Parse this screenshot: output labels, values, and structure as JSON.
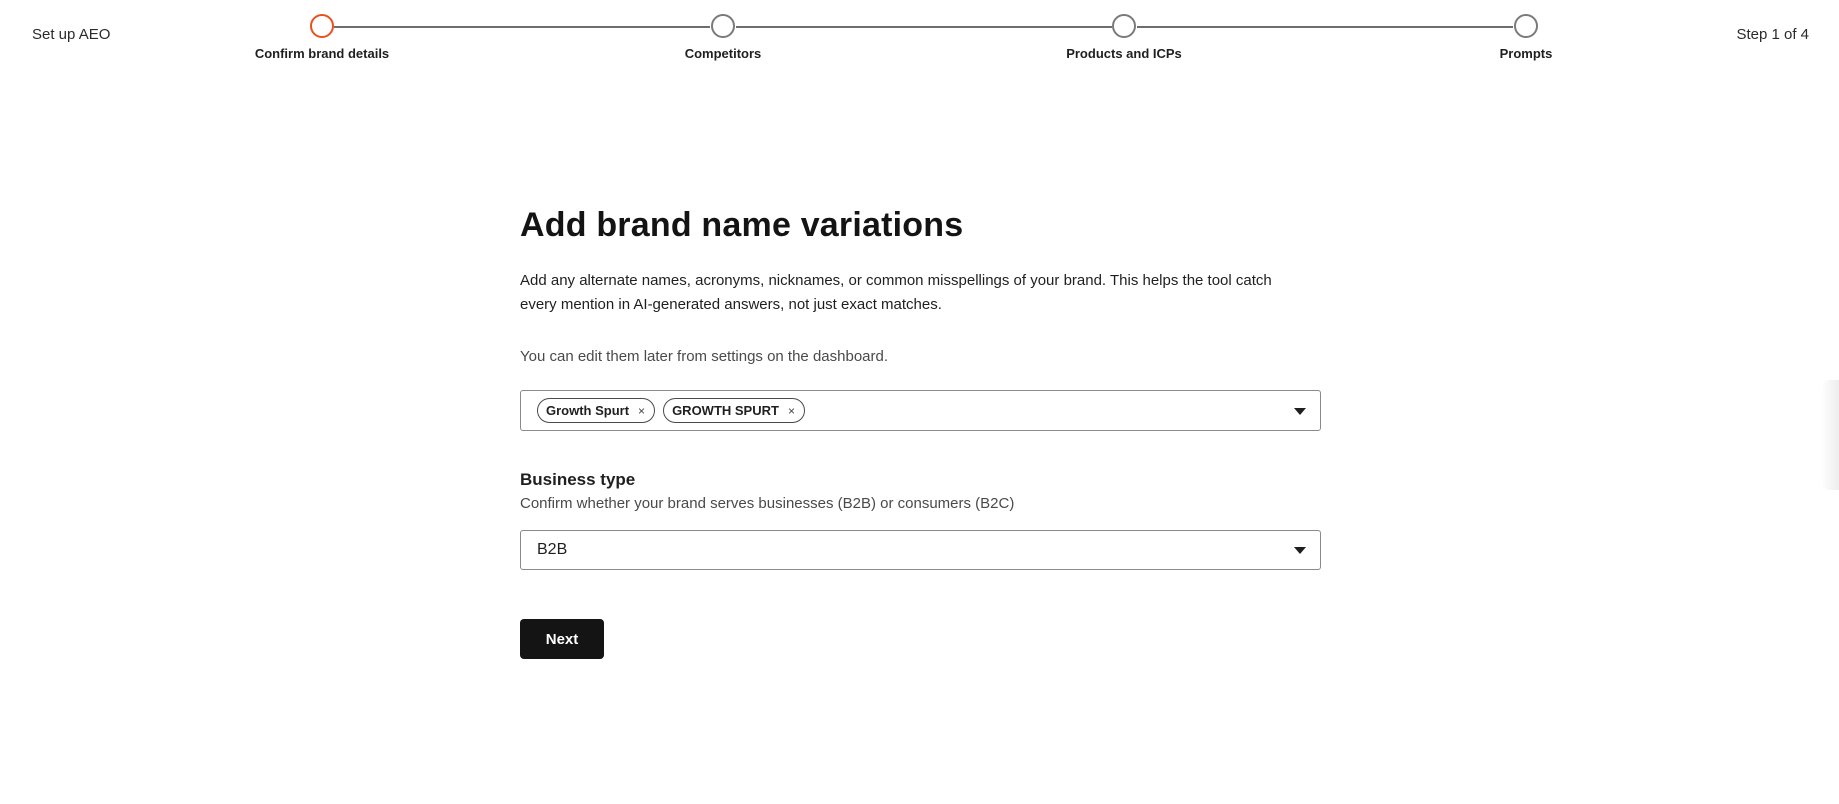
{
  "header": {
    "title": "Set up AEO",
    "step_counter": "Step 1 of 4"
  },
  "stepper": {
    "steps": [
      {
        "label": "Confirm brand details",
        "active": true
      },
      {
        "label": "Competitors",
        "active": false
      },
      {
        "label": "Products and ICPs",
        "active": false
      },
      {
        "label": "Prompts",
        "active": false
      }
    ],
    "active_color": "#ea4f1c"
  },
  "main": {
    "title": "Add brand name variations",
    "description": "Add any alternate names, acronyms, nicknames, or common misspellings of your brand. This helps the tool catch every mention in AI-generated answers, not just exact matches.",
    "hint": "You can edit them later from settings on the dashboard.",
    "variations": {
      "chips": [
        {
          "label": "Growth Spurt",
          "remove_icon": "×"
        },
        {
          "label": "GROWTH SPURT",
          "remove_icon": "×"
        }
      ]
    },
    "business_type": {
      "label": "Business type",
      "help": "Confirm whether your brand serves businesses (B2B) or consumers (B2C)",
      "selected": "B2B"
    },
    "next_label": "Next"
  }
}
